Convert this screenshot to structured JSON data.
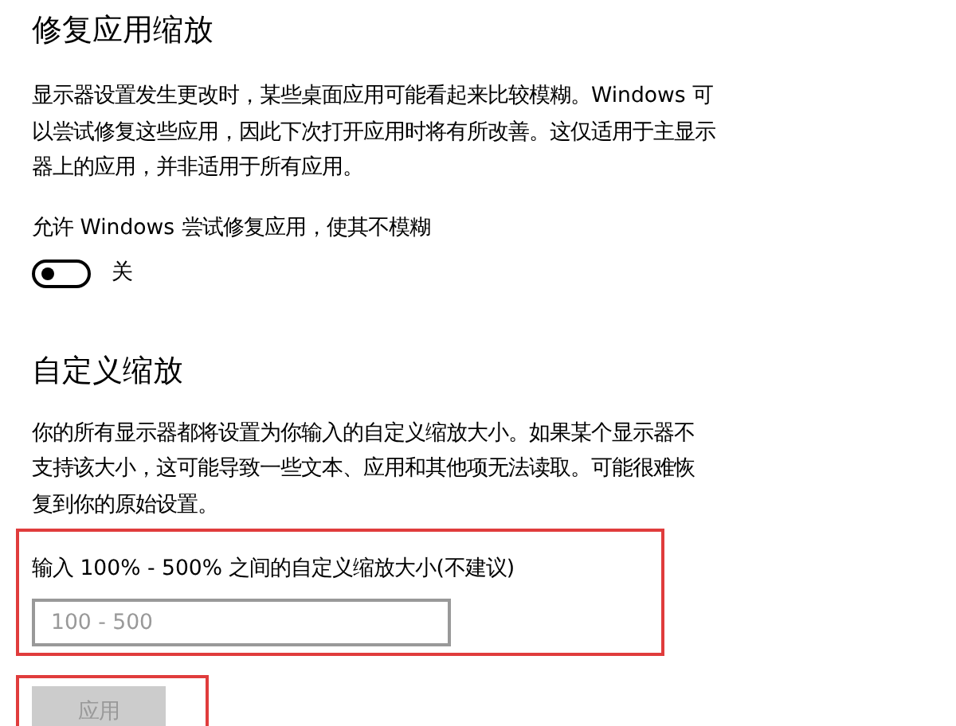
{
  "fix_scaling": {
    "title": "修复应用缩放",
    "description": "显示器设置发生更改时，某些桌面应用可能看起来比较模糊。Windows 可以尝试修复这些应用，因此下次打开应用时将有所改善。这仅适用于主显示器上的应用，并非适用于所有应用。",
    "toggle": {
      "label": "允许 Windows 尝试修复应用，使其不模糊",
      "on": false,
      "state_text": "关"
    }
  },
  "custom_scaling": {
    "title": "自定义缩放",
    "description": "你的所有显示器都将设置为你输入的自定义缩放大小。如果某个显示器不支持该大小，这可能导致一些文本、应用和其他项无法读取。可能很难恢复到你的原始设置。",
    "input": {
      "label": "输入 100% - 500% 之间的自定义缩放大小(不建议)",
      "placeholder": "100 - 500",
      "highlighted": true
    },
    "apply_button": {
      "label": "应用",
      "disabled": true,
      "highlighted": true
    }
  }
}
